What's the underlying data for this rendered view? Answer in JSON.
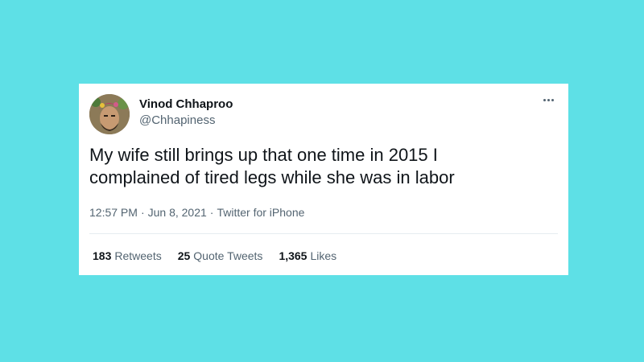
{
  "tweet": {
    "author": {
      "name": "Vinod Chhaproo",
      "handle": "@Chhapiness",
      "avatar_icon": "profile-photo"
    },
    "more_icon": "more-dots-icon",
    "text_lines": [
      "My wife still brings up that one time in 2015 I",
      "complained of tired legs while she was in labor"
    ],
    "time": "12:57 PM",
    "date": "Jun 8, 2021",
    "source": "Twitter for iPhone",
    "stats": {
      "retweets_count": "183",
      "retweets_label": "Retweets",
      "quotes_count": "25",
      "quotes_label": "Quote Tweets",
      "likes_count": "1,365",
      "likes_label": "Likes"
    }
  },
  "colors": {
    "background": "#5ee0e6",
    "card": "#ffffff",
    "primary_text": "#0f1419",
    "secondary_text": "#536471"
  }
}
